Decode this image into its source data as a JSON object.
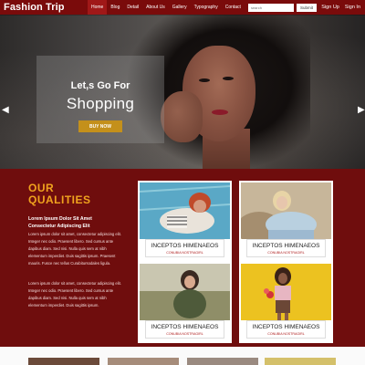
{
  "header": {
    "brand": "Fashion Trip",
    "nav": [
      {
        "label": "Home",
        "active": true
      },
      {
        "label": "Blog",
        "active": false
      },
      {
        "label": "Detail",
        "active": false
      },
      {
        "label": "About Us",
        "active": false
      },
      {
        "label": "Gallery",
        "active": false
      },
      {
        "label": "Typography",
        "active": false
      },
      {
        "label": "Contact",
        "active": false
      }
    ],
    "search_placeholder": "search",
    "search_button": "Submit",
    "sign_up": "Sign Up",
    "sign_in": "Sign In"
  },
  "hero": {
    "caption_small": "Let,s Go For",
    "caption_big": "Shopping",
    "button": "BUY NOW",
    "prev_icon": "chevron-left-icon",
    "next_icon": "chevron-right-icon",
    "slide_count": 3,
    "active_slide": 2
  },
  "qualities": {
    "title_line1": "OUR",
    "title_line2": "QUALITIES",
    "subtitle": "Lorem Ipsum Dolor Sit Amet Consectetur Adipiscing Elit",
    "paragraphs": [
      "Lorem ipsum dolor sit amet, consectetur adipiscing elit. Integer nec odio. Praesent libero. Sed cursus ante dapibus diam. Sed nisi. Nulla quis sem at nibh elementum imperdiet. Duis sagittis ipsum. Praesent mauris. Fusce nec tellus Curabitursodales ligula.",
      "Lorem ipsum dolor sit amet, consectetur adipiscing elit. Integer nec odio. Praesent libero. Sed cursus ante dapibus diam. Sed nisi. Nulla quis sem at nibh elementum imperdiet. Duis sagittis ipsum."
    ],
    "cards": [
      {
        "title": "INCEPTOS HIMENAEOS",
        "subtitle": "CONUBIA NOSTRAGIRL"
      },
      {
        "title": "INCEPTOS HIMENAEOS",
        "subtitle": "CONUBIA NOSTRAGIRL"
      },
      {
        "title": "INCEPTOS HIMENAEOS",
        "subtitle": "CONUBIA NOSTRAGIRL"
      },
      {
        "title": "INCEPTOS HIMENAEOS",
        "subtitle": "CONUBIA NOSTRAGIRL"
      }
    ]
  },
  "colors": {
    "header_bg": "#7a0b0b",
    "section_bg": "#6f0d0d",
    "accent_gold": "#c4901b",
    "title_orange": "#f0a31e"
  }
}
